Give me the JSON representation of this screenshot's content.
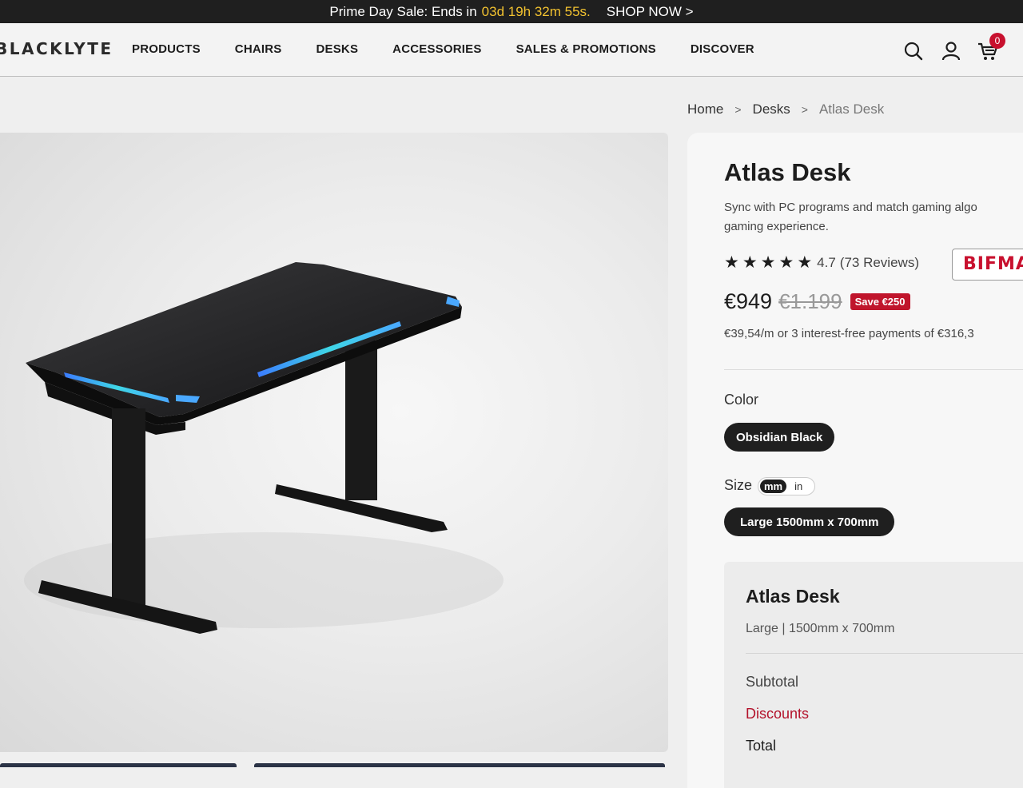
{
  "promo": {
    "text": "Prime Day Sale: Ends in",
    "countdown": "03d 19h 32m 55s.",
    "cta": "SHOP NOW >"
  },
  "header": {
    "logo": "BLACKLYTE",
    "nav": [
      "PRODUCTS",
      "CHAIRS",
      "DESKS",
      "ACCESSORIES",
      "SALES & PROMOTIONS",
      "DISCOVER"
    ],
    "cart_count": "0"
  },
  "breadcrumb": {
    "home": "Home",
    "category": "Desks",
    "current": "Atlas Desk",
    "separator": ">"
  },
  "product": {
    "title": "Atlas Desk",
    "description_line1": "Sync with PC programs and match gaming algo",
    "description_line2": "gaming experience.",
    "rating": "4.7",
    "reviews": "(73 Reviews)",
    "certification": "BIFMA",
    "price": "€949",
    "old_price": "€1.199",
    "save_badge": "Save €250",
    "financing": "€39,54/m or 3 interest-free payments of  €316,3",
    "color_label": "Color",
    "color_value": "Obsidian Black",
    "size_label": "Size",
    "unit_mm": "mm",
    "unit_in": "in",
    "size_value": "Large 1500mm x 700mm"
  },
  "summary": {
    "title": "Atlas Desk",
    "subtitle": "Large | 1500mm x 700mm",
    "subtotal_label": "Subtotal",
    "discounts_label": "Discounts",
    "total_label": "Total"
  },
  "colors": {
    "accent_red": "#c0152c",
    "countdown_yellow": "#f2c230",
    "dark": "#1f1f1f",
    "led_cyan": "#3fd6e6"
  }
}
